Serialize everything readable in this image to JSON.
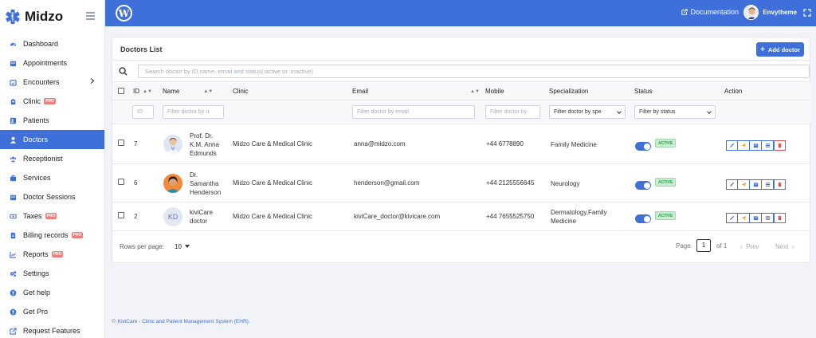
{
  "brand": {
    "name": "Midzo"
  },
  "sidebar": {
    "items": [
      {
        "label": "Dashboard",
        "icon": "dashboard-icon",
        "active": false,
        "pro": false
      },
      {
        "label": "Appointments",
        "icon": "calendar-icon",
        "active": false,
        "pro": false
      },
      {
        "label": "Encounters",
        "icon": "calendar-check-icon",
        "active": false,
        "pro": false
      },
      {
        "label": "Clinic",
        "icon": "hospital-icon",
        "active": false,
        "pro": true
      },
      {
        "label": "Patients",
        "icon": "patients-icon",
        "active": false,
        "pro": false
      },
      {
        "label": "Doctors",
        "icon": "user-md-icon",
        "active": true,
        "pro": false
      },
      {
        "label": "Receptionist",
        "icon": "users-icon",
        "active": false,
        "pro": false
      },
      {
        "label": "Services",
        "icon": "services-icon",
        "active": false,
        "pro": false
      },
      {
        "label": "Doctor Sessions",
        "icon": "calendar-icon",
        "active": false,
        "pro": false
      },
      {
        "label": "Taxes",
        "icon": "money-icon",
        "active": false,
        "pro": true
      },
      {
        "label": "Billing records",
        "icon": "file-icon",
        "active": false,
        "pro": true
      },
      {
        "label": "Reports",
        "icon": "chart-icon",
        "active": false,
        "pro": true
      },
      {
        "label": "Settings",
        "icon": "gears-icon",
        "active": false,
        "pro": false
      },
      {
        "label": "Get help",
        "icon": "question-icon",
        "active": false,
        "pro": false
      },
      {
        "label": "Get Pro",
        "icon": "question-icon",
        "active": false,
        "pro": false
      },
      {
        "label": "Request Features",
        "icon": "external-link-icon",
        "active": false,
        "pro": false
      }
    ],
    "pro_label": "PRO"
  },
  "topbar": {
    "documentation": "Documentation",
    "user_name": "Envytheme"
  },
  "page": {
    "title": "Doctors List",
    "add_button": "Add doctor"
  },
  "search": {
    "placeholder": "Search doctor by ID,name, email and status(:active or :inactive)"
  },
  "table": {
    "columns": {
      "id": "ID",
      "name": "Name",
      "clinic": "Clinic",
      "email": "Email",
      "mobile": "Mobile",
      "specialization": "Specialization",
      "status": "Status",
      "action": "Action"
    },
    "filters": {
      "id": "ID",
      "name": "Filter doctor by n",
      "email": "Filter doctor by email",
      "mobile": "Filter doctor by",
      "specialization": "Filter doctor by spe",
      "status": "Filter by status"
    },
    "rows": [
      {
        "id": "7",
        "name_lines": [
          "Prof. Dr.",
          "K.M. Anna",
          "Edmunds"
        ],
        "clinic": "Midzo Care & Medical Clinic",
        "email": "anna@midzo.com",
        "mobile": "+44 6778890",
        "specialization_lines": [
          "Family Medicine"
        ],
        "status": "ACTIVE",
        "avatar": "photo"
      },
      {
        "id": "6",
        "name_lines": [
          "Dr.",
          "Samantha",
          "Henderson"
        ],
        "clinic": "Midzo Care & Medical Clinic",
        "email": "henderson@gmail.com",
        "mobile": "+44 2125556645",
        "specialization_lines": [
          "Neurology"
        ],
        "status": "ACTIVE",
        "avatar": "photo"
      },
      {
        "id": "2",
        "name_lines": [
          "kiviCare",
          "doctor"
        ],
        "clinic": "Midzo Care & Medical Clinic",
        "email": "kiviCare_doctor@kivicare.com",
        "mobile": "+44 7655525750",
        "specialization_lines": [
          "Dermatology,Family",
          "Medicine"
        ],
        "status": "ACTIVE",
        "avatar": "KD"
      }
    ]
  },
  "pagination": {
    "rows_per_page_label": "Rows per page:",
    "rows_per_page": "10",
    "page_label": "Page",
    "page": "1",
    "of_label": "of 1",
    "prev": "Prev",
    "next": "Next"
  },
  "footer": {
    "copyright": "©",
    "text": "KiviCare - Clinic and Patient Management System (EHR)."
  },
  "colors": {
    "primary": "#3f6fd8",
    "pro_badge": "#f27d7d",
    "active_badge": "#c8efd2",
    "delete": "#e04b4b"
  }
}
